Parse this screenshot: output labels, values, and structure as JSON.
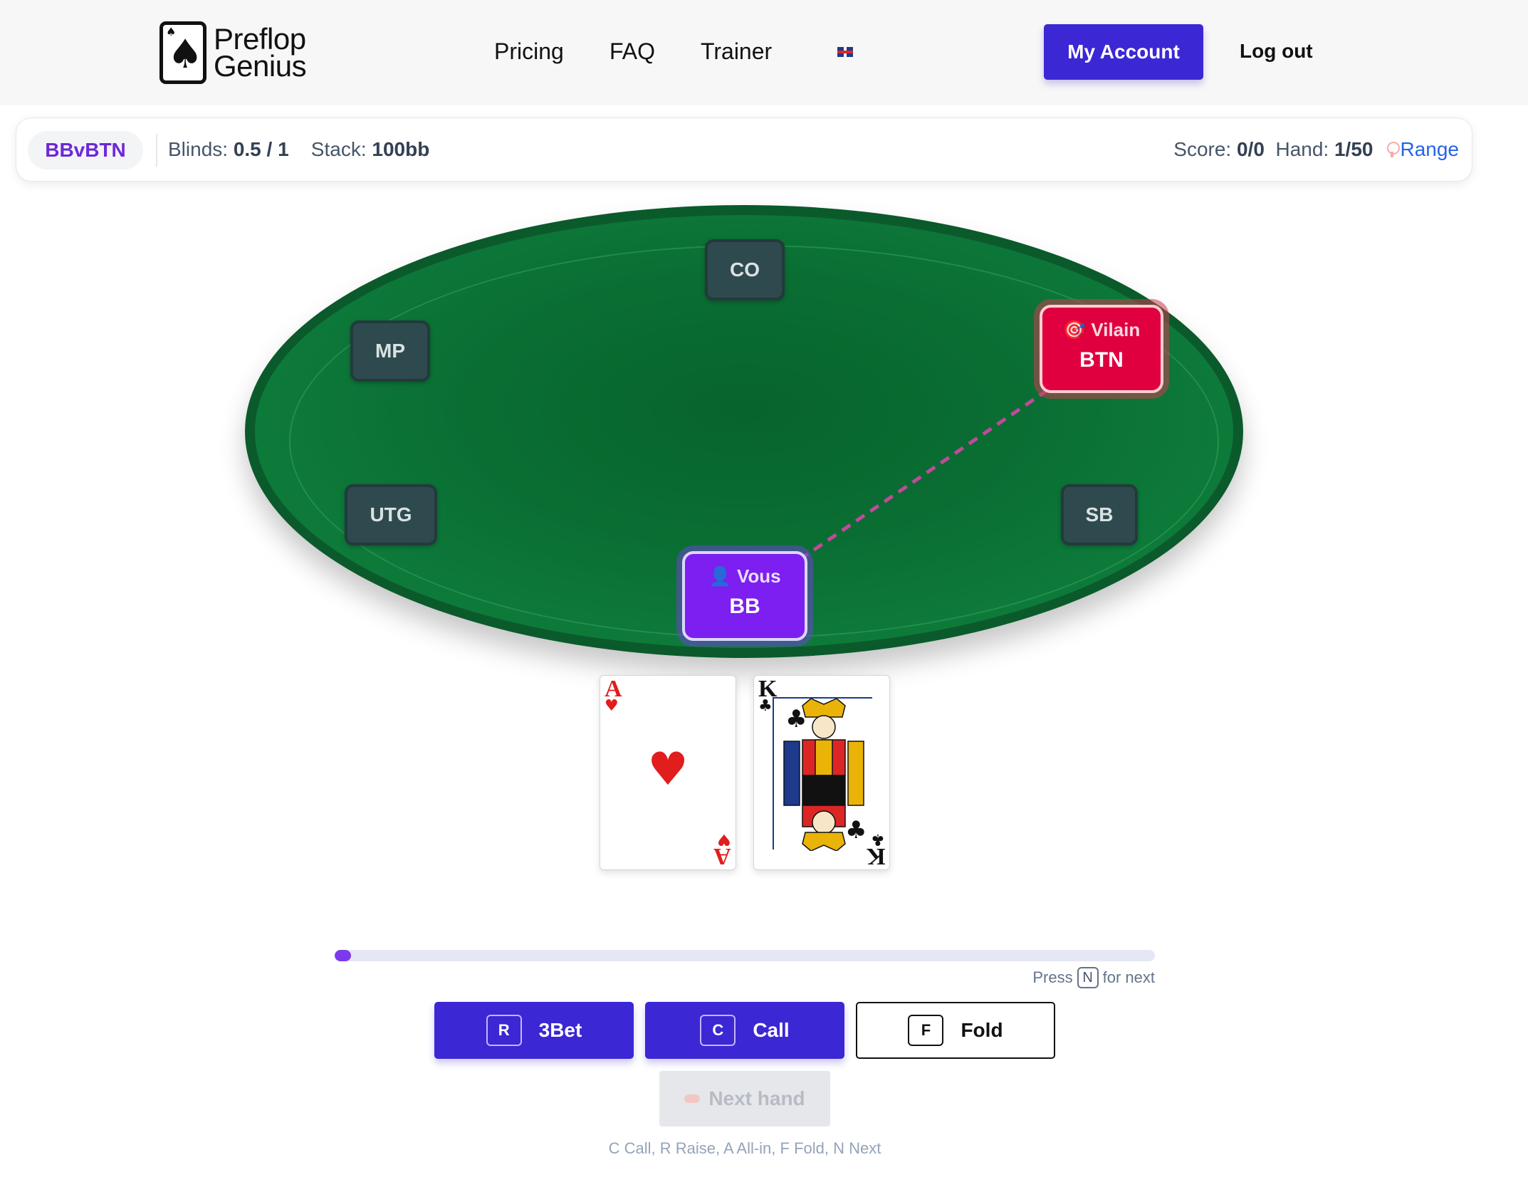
{
  "header": {
    "logo_line1": "Preflop",
    "logo_line2": "Genius",
    "nav": [
      "Pricing",
      "FAQ",
      "Trainer"
    ],
    "language_flag": "uk-flag-icon",
    "account_label": "My Account",
    "logout_label": "Log out"
  },
  "infobar": {
    "mode": "BBvBTN",
    "blinds_label": "Blinds:",
    "blinds_value": "0.5 / 1",
    "stack_label": "Stack:",
    "stack_value": "100bb",
    "score_label": "Score:",
    "score_value": "0/0",
    "hand_label": "Hand:",
    "hand_value": "1/50",
    "range_label": "Range"
  },
  "table": {
    "seats": [
      "CO",
      "MP",
      "UTG",
      "SB"
    ],
    "villain": {
      "tag": "Vilain",
      "position": "BTN"
    },
    "hero": {
      "tag": "Vous",
      "position": "BB"
    }
  },
  "cards": [
    {
      "rank": "A",
      "suit": "♥",
      "color": "#e11d1d"
    },
    {
      "rank": "K",
      "suit": "♣",
      "color": "#111111"
    }
  ],
  "progress": {
    "value": 0.02,
    "hint_pre": "Press",
    "hint_key": "N",
    "hint_post": "for next"
  },
  "actions": [
    {
      "key": "R",
      "label": "3Bet",
      "style": "primary"
    },
    {
      "key": "C",
      "label": "Call",
      "style": "primary"
    },
    {
      "key": "F",
      "label": "Fold",
      "style": "outline"
    }
  ],
  "next_hand_label": "Next hand",
  "shortcuts": "C Call, R Raise, A All-in, F Fold, N Next",
  "colors": {
    "accent": "#3b27d4",
    "hero": "#7c1ff0",
    "villain": "#e0003f",
    "felt": "#0a6e33"
  }
}
